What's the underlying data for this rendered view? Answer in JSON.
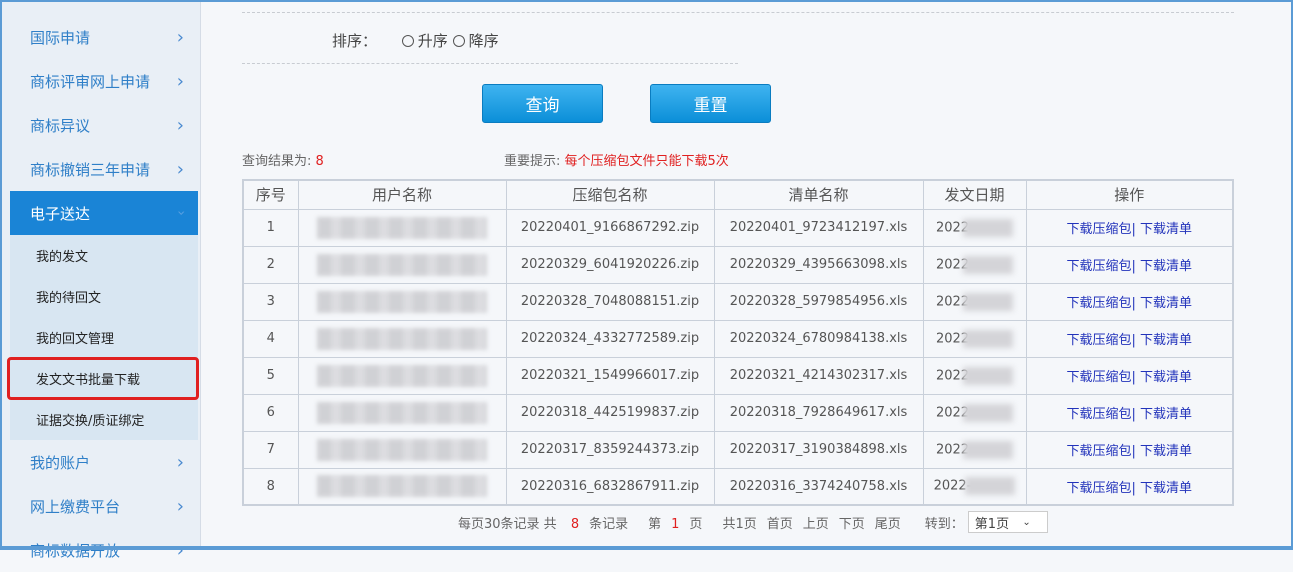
{
  "sidebar": {
    "items": [
      {
        "label": "国际申请"
      },
      {
        "label": "商标评审网上申请"
      },
      {
        "label": "商标异议"
      },
      {
        "label": "商标撤销三年申请"
      },
      {
        "label": "电子送达"
      }
    ],
    "sub_items": [
      {
        "label": "我的发文"
      },
      {
        "label": "我的待回文"
      },
      {
        "label": "我的回文管理"
      },
      {
        "label": "发文文书批量下载"
      },
      {
        "label": "证据交换/质证绑定"
      }
    ],
    "items_after": [
      {
        "label": "我的账户"
      },
      {
        "label": "网上缴费平台"
      },
      {
        "label": "商标数据开放"
      }
    ]
  },
  "sort": {
    "label": "排序：",
    "asc": "升序",
    "desc": "降序"
  },
  "buttons": {
    "query": "查询",
    "reset": "重置"
  },
  "result": {
    "label": "查询结果为:",
    "count": "8"
  },
  "notice": {
    "label": "重要提示:",
    "text": "每个压缩包文件只能下载5次"
  },
  "table": {
    "headers": [
      "序号",
      "用户名称",
      "压缩包名称",
      "清单名称",
      "发文日期",
      "操作"
    ],
    "rows": [
      {
        "no": "1",
        "zip": "20220401_9166867292.zip",
        "list": "20220401_9723412197.xls",
        "date": "2022"
      },
      {
        "no": "2",
        "zip": "20220329_6041920226.zip",
        "list": "20220329_4395663098.xls",
        "date": "2022"
      },
      {
        "no": "3",
        "zip": "20220328_7048088151.zip",
        "list": "20220328_5979854956.xls",
        "date": "2022"
      },
      {
        "no": "4",
        "zip": "20220324_4332772589.zip",
        "list": "20220324_6780984138.xls",
        "date": "2022"
      },
      {
        "no": "5",
        "zip": "20220321_1549966017.zip",
        "list": "20220321_4214302317.xls",
        "date": "2022"
      },
      {
        "no": "6",
        "zip": "20220318_4425199837.zip",
        "list": "20220318_7928649617.xls",
        "date": "2022"
      },
      {
        "no": "7",
        "zip": "20220317_8359244373.zip",
        "list": "20220317_3190384898.xls",
        "date": "2022"
      },
      {
        "no": "8",
        "zip": "20220316_6832867911.zip",
        "list": "20220316_3374240758.xls",
        "date": "2022-"
      }
    ],
    "op_zip": "下载压缩包|",
    "op_list": "下载清单"
  },
  "pager": {
    "per_page": "每页30条记录 共",
    "total": "8",
    "total_suffix": "条记录",
    "page_prefix": "第",
    "page": "1",
    "page_suffix": "页",
    "pages": "共1页",
    "first": "首页",
    "prev": "上页",
    "next": "下页",
    "last": "尾页",
    "goto": "转到：",
    "select": "第1页"
  }
}
